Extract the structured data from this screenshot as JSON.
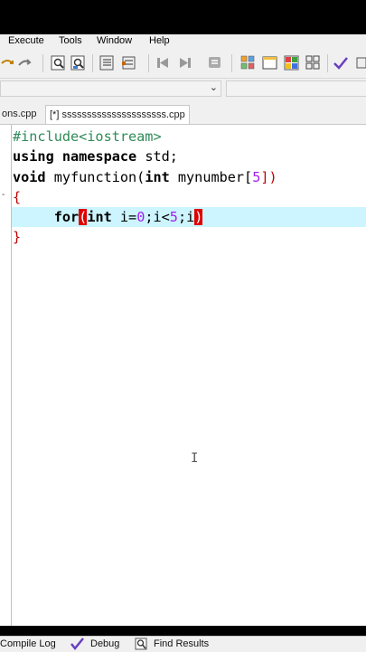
{
  "menu": {
    "items": [
      "Execute",
      "Tools",
      "Window",
      "Help"
    ]
  },
  "toolbar": {
    "icons": [
      "undo-icon",
      "redo-icon",
      "find-icon",
      "replace-icon",
      "indent-icon",
      "unindent-icon",
      "back-icon",
      "forward-icon",
      "bookmark-icon",
      "class-browser-icon",
      "window-icon",
      "color-grid-icon",
      "grid-icon",
      "check-icon",
      "extra-icon"
    ]
  },
  "tabs": [
    {
      "label": "ons.cpp"
    },
    {
      "label": "[*] sssssssssssssssssssss.cpp"
    }
  ],
  "code": {
    "line1": "#include<iostream>",
    "line2_kw1": "using",
    "line2_kw2": "namespace",
    "line2_rest": " std;",
    "line3_kw": "void",
    "line3_mid": " myfunction(",
    "line3_kw2": "int",
    "line3_mid2": " mynumber[",
    "line3_num": "5",
    "line3_end": "])",
    "line4": "{",
    "line5_indent": "     ",
    "line5_kw": "for",
    "line5_open": "(",
    "line5_kw2": "int",
    "line5_var": " i=",
    "line5_n0": "0",
    "line5_semi": ";i<",
    "line5_n5": "5",
    "line5_tail": ";i",
    "line5_close": ")",
    "line6": "}"
  },
  "bottom_tabs": {
    "compile_log": "Compile Log",
    "debug": "Debug",
    "find_results": "Find Results"
  }
}
